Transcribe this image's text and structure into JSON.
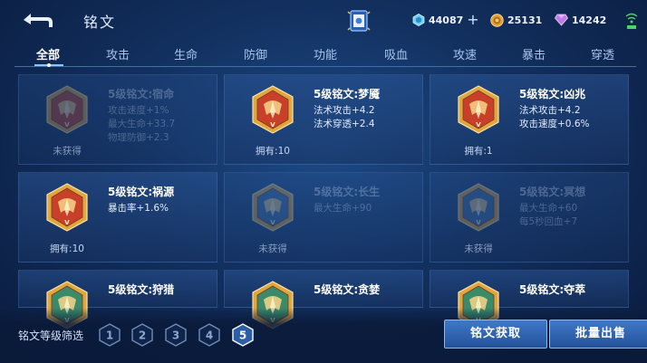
{
  "header": {
    "title": "铭文",
    "currencies": [
      {
        "icon": "diamond-coupon-icon",
        "value": "44087",
        "has_plus": true
      },
      {
        "icon": "gold-coin-icon",
        "value": "25131",
        "has_plus": false
      },
      {
        "icon": "purple-crystal-icon",
        "value": "14242",
        "has_plus": false
      }
    ],
    "plus": "+"
  },
  "tabs": [
    {
      "label": "全部",
      "active": true
    },
    {
      "label": "攻击"
    },
    {
      "label": "生命"
    },
    {
      "label": "防御"
    },
    {
      "label": "功能"
    },
    {
      "label": "吸血"
    },
    {
      "label": "攻速"
    },
    {
      "label": "暴击"
    },
    {
      "label": "穿透"
    }
  ],
  "cards": [
    {
      "name": "5级铭文:宿命",
      "stats": [
        "攻击速度+1%",
        "最大生命+33.7",
        "物理防御+2.3"
      ],
      "owned": "未获得",
      "color": "red",
      "dim": true
    },
    {
      "name": "5级铭文:梦魇",
      "stats": [
        "法术攻击+4.2",
        "法术穿透+2.4"
      ],
      "owned": "拥有:10",
      "color": "red",
      "dim": false
    },
    {
      "name": "5级铭文:凶兆",
      "stats": [
        "法术攻击+4.2",
        "攻击速度+0.6%"
      ],
      "owned": "拥有:1",
      "color": "red",
      "dim": false
    },
    {
      "name": "5级铭文:祸源",
      "stats": [
        "暴击率+1.6%"
      ],
      "owned": "拥有:10",
      "color": "red",
      "dim": false
    },
    {
      "name": "5级铭文:长生",
      "stats": [
        "最大生命+90"
      ],
      "owned": "未获得",
      "color": "blue",
      "dim": true
    },
    {
      "name": "5级铭文:冥想",
      "stats": [
        "最大生命+60",
        "每5秒回血+7"
      ],
      "owned": "未获得",
      "color": "blue",
      "dim": true
    },
    {
      "name": "5级铭文:狩猎",
      "stats": [],
      "owned": "",
      "color": "green",
      "dim": false
    },
    {
      "name": "5级铭文:贪婪",
      "stats": [],
      "owned": "",
      "color": "green",
      "dim": false
    },
    {
      "name": "5级铭文:夺萃",
      "stats": [],
      "owned": "",
      "color": "green",
      "dim": false
    }
  ],
  "bottom": {
    "filter_label": "铭文等级筛选",
    "levels": [
      "1",
      "2",
      "3",
      "4",
      "5"
    ],
    "active_level": "5",
    "obtain_button": "铭文获取",
    "sell_button": "批量出售"
  },
  "colors": {
    "red_gem": "#c8402a",
    "gold_frame": "#e0a640",
    "blue_gem": "#3c6fa8",
    "green_gem": "#3b8a6a",
    "accent": "#3f78c8"
  }
}
